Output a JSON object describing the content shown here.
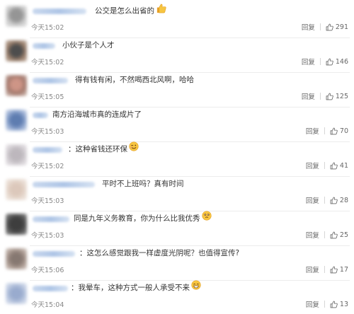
{
  "colors": {
    "text": "#333333",
    "meta": "#888888",
    "name_blur": "#aec5e6",
    "divider": "#ececec"
  },
  "icons": {
    "like": "thumb-up-outline-icon",
    "emoji": [
      "thumbs-up-emoji",
      "wink-emoji",
      "smirk-emoji",
      "grin-emoji"
    ]
  },
  "comments": [
    {
      "text": "公交是怎么出省的",
      "time": "今天15:02",
      "reply": "回复",
      "likes": "291",
      "emoji": "thumbs-up-emoji"
    },
    {
      "text": "小伙子是个人才",
      "time": "今天15:02",
      "reply": "回复",
      "likes": "146"
    },
    {
      "text": "得有钱有闲，不然喝西北风啊，哈哈",
      "time": "今天15:05",
      "reply": "回复",
      "likes": "125"
    },
    {
      "text": "南方沿海城市真的连成片了",
      "time": "今天15:03",
      "reply": "回复",
      "likes": "70"
    },
    {
      "text": "：这种省钱还环保",
      "time": "今天15:02",
      "reply": "回复",
      "likes": "41",
      "emoji": "wink-emoji"
    },
    {
      "text": "平时不上班吗？真有时间",
      "time": "今天15:03",
      "reply": "回复",
      "likes": "28"
    },
    {
      "text": "同是九年义务教育，你为什么比我优秀",
      "time": "今天15:03",
      "reply": "回复",
      "likes": "25",
      "emoji": "smirk-emoji"
    },
    {
      "text": "：这怎么感觉跟我一样虚度光阴呢？也值得宣传?",
      "time": "今天15:06",
      "reply": "回复",
      "likes": "17"
    },
    {
      "text": "：我晕车，这种方式一般人承受不来",
      "time": "今天15:04",
      "reply": "回复",
      "likes": "13",
      "emoji": "grin-emoji"
    }
  ]
}
